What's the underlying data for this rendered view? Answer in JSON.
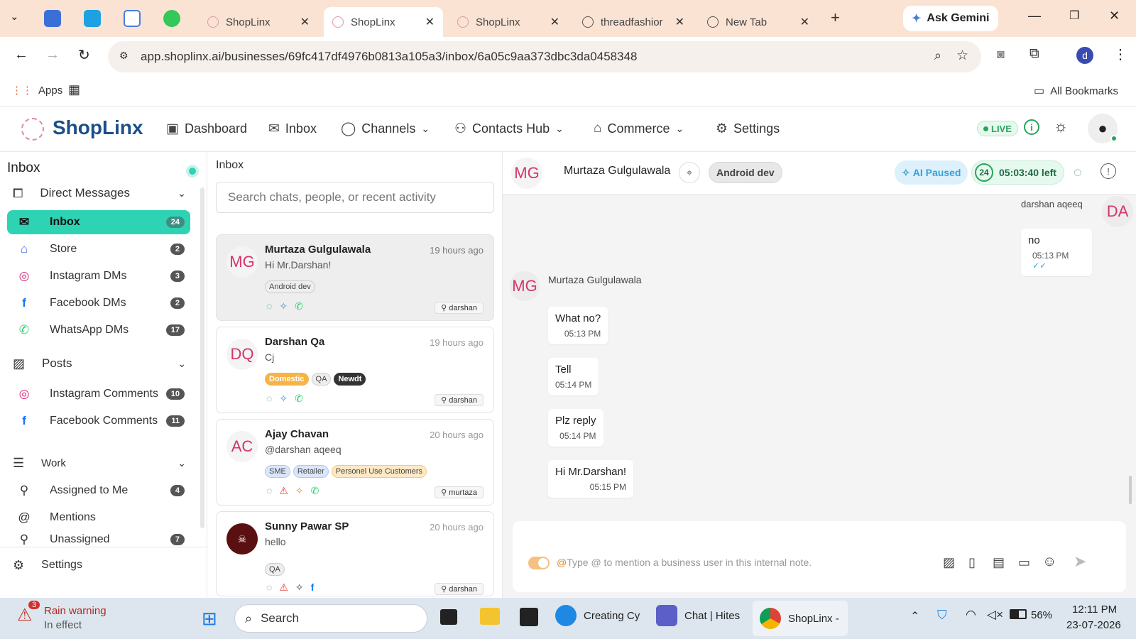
{
  "browser": {
    "tabs": [
      {
        "title": "ShopLinx"
      },
      {
        "title": "ShopLinx"
      },
      {
        "title": "ShopLinx"
      },
      {
        "title": "threadfashior"
      },
      {
        "title": "New Tab"
      }
    ],
    "gemini_label": "Ask Gemini",
    "url": "app.shoplinx.ai/businesses/69fc417df4976b0813a105a3/inbox/6a05c9aa373dbc3da0458348",
    "profile_initial": "d",
    "bookmarks": {
      "apps": "Apps",
      "all": "All Bookmarks"
    }
  },
  "header": {
    "logo": "ShopLinx",
    "nav": [
      {
        "label": "Dashboard",
        "icon": "dashboard-icon"
      },
      {
        "label": "Inbox",
        "icon": "inbox-icon"
      },
      {
        "label": "Channels",
        "icon": "chat-bubble-icon"
      },
      {
        "label": "Contacts Hub",
        "icon": "people-icon"
      },
      {
        "label": "Commerce",
        "icon": "store-icon"
      },
      {
        "label": "Settings",
        "icon": "gear-icon"
      }
    ],
    "live_badge": "LIVE"
  },
  "sidebar": {
    "title": "Inbox",
    "direct_messages": "Direct Messages",
    "dm_items": [
      {
        "label": "Inbox",
        "count": "24"
      },
      {
        "label": "Store",
        "count": "2"
      },
      {
        "label": "Instagram DMs",
        "count": "3"
      },
      {
        "label": "Facebook DMs",
        "count": "2"
      },
      {
        "label": "WhatsApp DMs",
        "count": "17"
      }
    ],
    "posts": "Posts",
    "post_items": [
      {
        "label": "Instagram Comments",
        "count": "10"
      },
      {
        "label": "Facebook Comments",
        "count": "11"
      }
    ],
    "work": "Work",
    "work_items": [
      {
        "label": "Assigned to Me",
        "count": "4"
      },
      {
        "label": "Mentions",
        "count": ""
      },
      {
        "label": "Unassigned",
        "count": "7"
      }
    ],
    "settings": "Settings"
  },
  "chatlist": {
    "title": "Inbox",
    "search_placeholder": "Search chats, people, or recent activity",
    "chats": [
      {
        "initials": "MG",
        "name": "Murtaza Gulgulawala",
        "time": "19 hours ago",
        "preview": "Hi Mr.Darshan!",
        "tags": [
          "Android dev"
        ],
        "agent": "darshan"
      },
      {
        "initials": "DQ",
        "name": "Darshan Qa",
        "time": "19 hours ago",
        "preview": "Cj",
        "tags": [
          "Domestic",
          "QA",
          "Newdt"
        ],
        "agent": "darshan"
      },
      {
        "initials": "AC",
        "name": "Ajay Chavan",
        "time": "20 hours ago",
        "preview": "@darshan aqeeq",
        "tags": [
          "SME",
          "Retailer",
          "Personel Use Customers"
        ],
        "agent": "murtaza"
      },
      {
        "initials": "",
        "name": "Sunny Pawar SP",
        "time": "20 hours ago",
        "preview": "hello",
        "tags": [
          "QA"
        ],
        "agent": "darshan"
      }
    ]
  },
  "conversation": {
    "initials": "MG",
    "name": "Murtaza Gulgulawala",
    "tag": "Android dev",
    "ai_status": "AI Paused",
    "window_hours": "24",
    "time_left": "05:03:40 left",
    "outgoing_sender": "darshan aqeeq",
    "outgoing_initials": "DA",
    "outgoing": [
      {
        "text": "no",
        "time": "05:13 PM"
      }
    ],
    "incoming_sender": "Murtaza Gulgulawala",
    "incoming": [
      {
        "text": "What no?",
        "time": "05:13 PM"
      },
      {
        "text": "Tell",
        "time": "05:14 PM"
      },
      {
        "text": "Plz reply",
        "time": "05:14 PM"
      },
      {
        "text": "Hi Mr.Darshan!",
        "time": "05:15 PM"
      }
    ],
    "composer_placeholder": "Type @ to mention a business user in this internal note."
  },
  "taskbar": {
    "weather_title": "Rain warning",
    "weather_sub": "In effect",
    "weather_badge": "3",
    "search": "Search",
    "apps": [
      {
        "label": "Creating Cy"
      },
      {
        "label": "Chat | Hites"
      },
      {
        "label": "ShopLinx -"
      }
    ],
    "battery": "56%",
    "time": "12:11 PM",
    "date": "23-07-2026"
  },
  "colors": {
    "accent": "#2ed3b3",
    "brand": "#1b4f8a",
    "initials": "#d6336c"
  }
}
